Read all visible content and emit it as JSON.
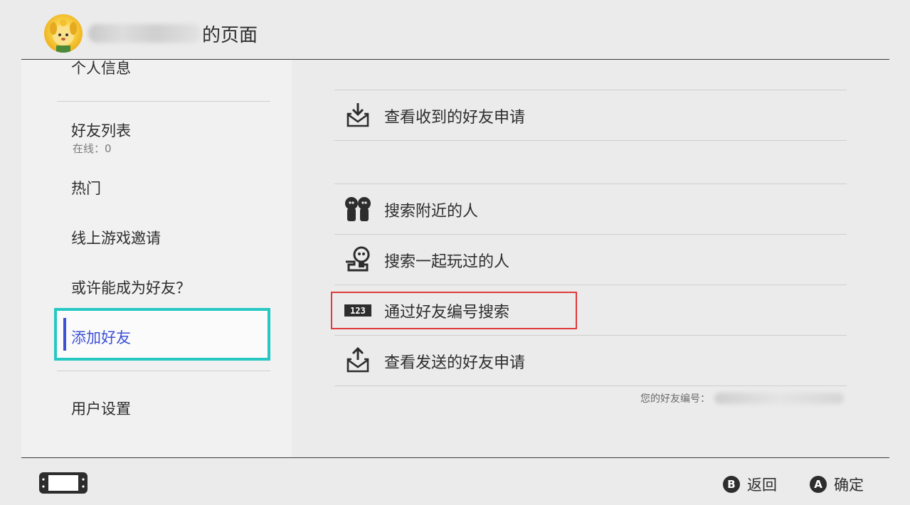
{
  "header": {
    "title": "的页面",
    "username_obscured": true
  },
  "sidebar": {
    "items": [
      {
        "label": "个人信息"
      },
      {
        "label": "好友列表",
        "sub": "在线：0"
      },
      {
        "label": "热门"
      },
      {
        "label": "线上游戏邀请"
      },
      {
        "label": "或许能成为好友？"
      },
      {
        "label": "添加好友",
        "selected": true
      },
      {
        "label": "用户设置"
      }
    ]
  },
  "menu": {
    "items": [
      {
        "label": "查看收到的好友申请",
        "icon": "inbox-download-icon"
      },
      {
        "label": "搜索附近的人",
        "icon": "nearby-people-icon"
      },
      {
        "label": "搜索一起玩过的人",
        "icon": "played-with-icon"
      },
      {
        "label": "通过好友编号搜索",
        "icon": "friend-code-123-icon",
        "highlighted": true
      },
      {
        "label": "查看发送的好友申请",
        "icon": "outbox-upload-icon"
      }
    ]
  },
  "friend_code": {
    "label": "您的好友编号："
  },
  "footer": {
    "back": {
      "button": "B",
      "label": "返回"
    },
    "confirm": {
      "button": "A",
      "label": "确定"
    }
  },
  "colors": {
    "selection_border": "#26c8c4",
    "selected_text": "#3c50d8",
    "highlight_box": "#e03a3a"
  }
}
